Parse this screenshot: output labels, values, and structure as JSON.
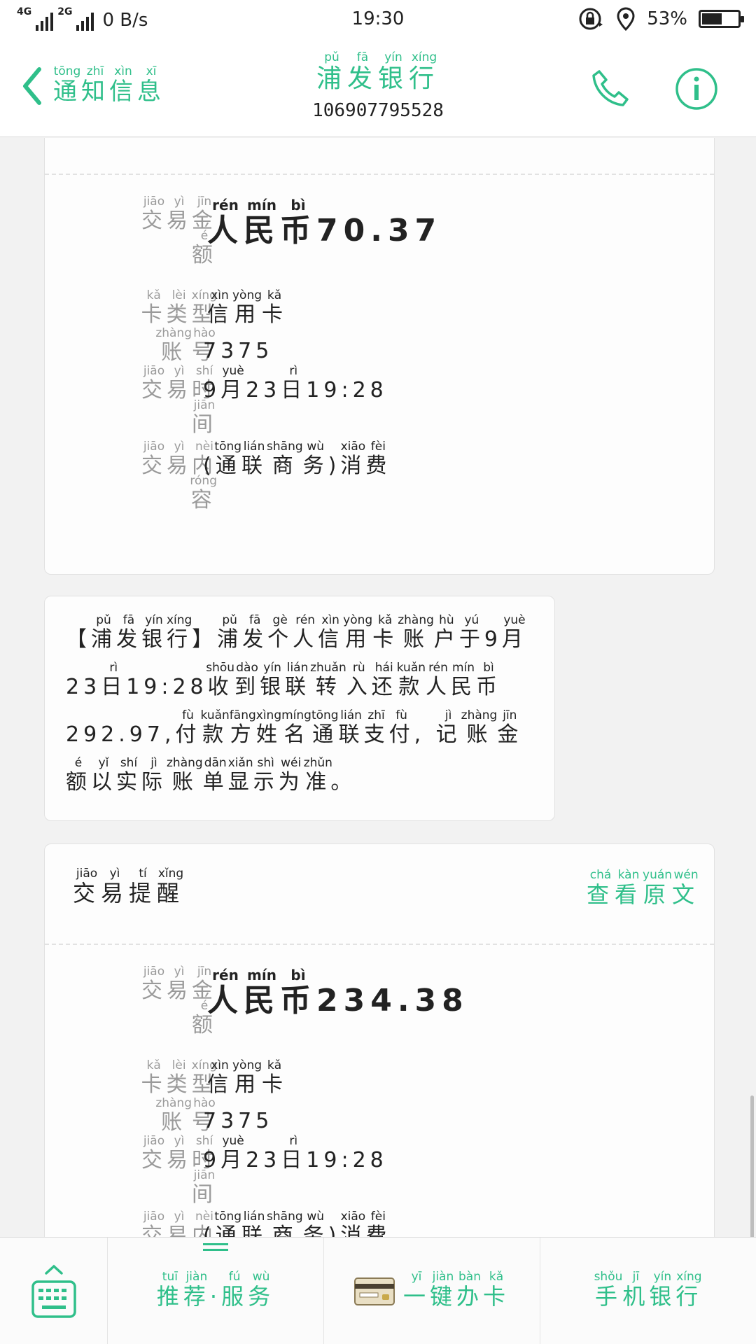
{
  "status_bar": {
    "net1": "4G",
    "net2": "2G",
    "speed": "0 B/s",
    "time": "19:30",
    "battery": "53%",
    "battery_level": 0.53
  },
  "header": {
    "back_label": "通知信息",
    "title": "浦发银行",
    "number": "106907795528"
  },
  "cards": [
    {
      "amount_label": "交易金额",
      "amount": "人民币70.37",
      "card_type_label": "卡类型",
      "card_type": "信用卡",
      "account_label": "账号",
      "account": "7375",
      "time_label": "交易时间",
      "time": "9月23日19:28",
      "content_label": "交易内容",
      "content": "(通联商务)消费"
    },
    {
      "title": "交易提醒",
      "view_original": "查看原文",
      "amount_label": "交易金额",
      "amount": "人民币234.38",
      "card_type_label": "卡类型",
      "card_type": "信用卡",
      "account_label": "账号",
      "account": "7375",
      "time_label": "交易时间",
      "time": "9月23日19:28"
    }
  ],
  "message": {
    "text": "【浦发银行】浦发个人信用卡账户于9月23日19:28收到银联转入还款人民币292.97,付款方姓名通联支付, 记账金额以实际账单显示为准。"
  },
  "bottom_bar": {
    "recommend": "推荐·服务",
    "apply_card": "一键办卡",
    "mobile_bank": "手机银行"
  },
  "colors": {
    "accent": "#2fbf8a",
    "label_gray": "#9a9a9a"
  }
}
